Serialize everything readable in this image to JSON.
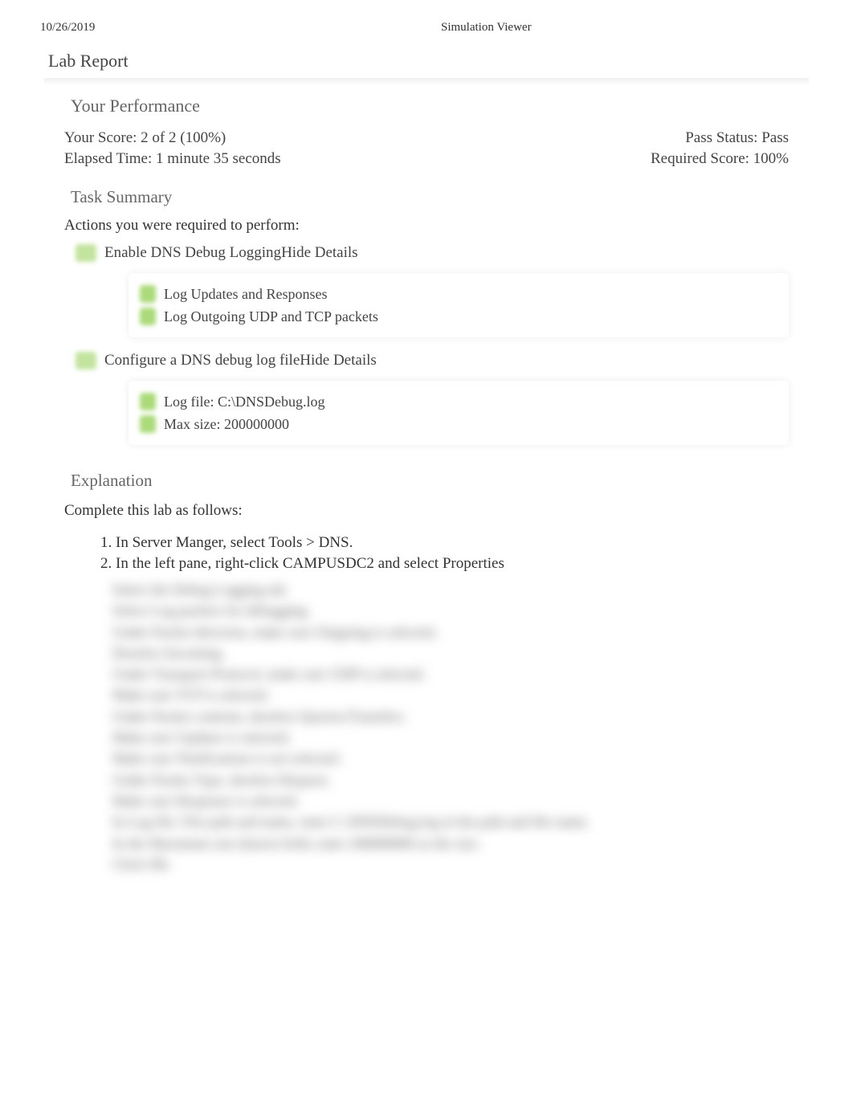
{
  "header": {
    "date": "10/26/2019",
    "app_title": "Simulation Viewer"
  },
  "page_title": "Lab Report",
  "performance": {
    "heading": "Your Performance",
    "score_label": "Your Score: 2 of 2 (100%)",
    "pass_status": "Pass Status: Pass",
    "elapsed_time": "Elapsed Time: 1 minute 35 seconds",
    "required_score": "Required Score: 100%"
  },
  "task_summary": {
    "heading": "Task Summary",
    "actions_header": "Actions you were required to perform:",
    "tasks": [
      {
        "label": "Enable DNS Debug Logging ",
        "hide_text": "Hide Details",
        "details": [
          "Log Updates and Responses",
          "Log Outgoing UDP and TCP packets"
        ]
      },
      {
        "label": "Configure a DNS debug log file",
        "hide_text": "Hide Details",
        "details": [
          "Log file: C:\\DNSDebug.log",
          "Max size: 200000000"
        ]
      }
    ]
  },
  "explanation": {
    "heading": "Explanation",
    "intro": "Complete this lab as follows:",
    "steps": [
      "In Server Manger, select Tools > DNS.",
      "In the left pane, right-click CAMPUSDC2  and select Properties"
    ],
    "blurred_lines": [
      "Select the Debug Logging tab.",
      "Select Log packets for debugging.",
      "Under Packet direction, make sure Outgoing is selected.",
      "Deselect Incoming.",
      "Under Transport Protocol, make sure UDP is selected.",
      "Make sure TCP is selected.",
      "Under Packet contents, deselect Queries/Transfers.",
      "Make sure Updates is selected.",
      "Make sure Notifications is not selected.",
      "Under Packet Type, deselect Request.",
      "Make sure Response is selected.",
      "In Log file: File path and name, enter C:\\DNSDebug.log in the path and file name.",
      "In the Maximum size (bytes) field, enter 200000000 as the size.",
      "Click OK."
    ]
  }
}
